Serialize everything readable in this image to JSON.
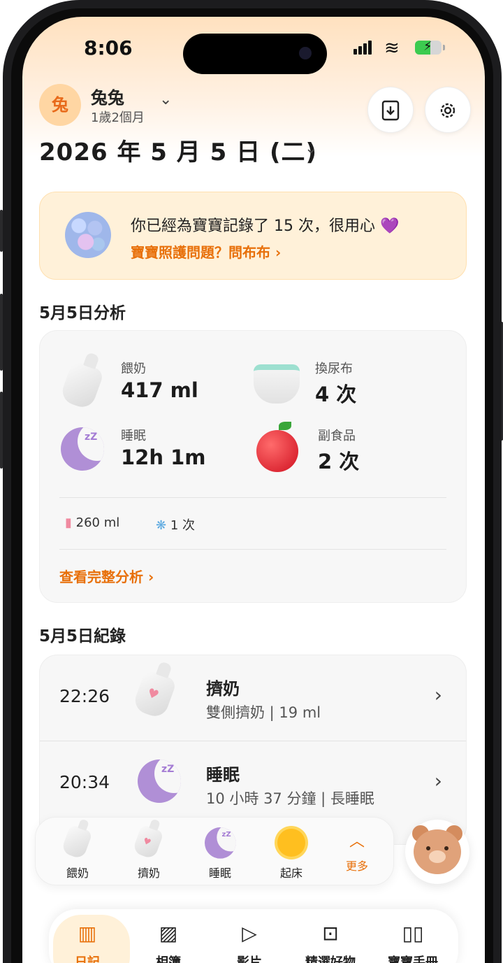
{
  "status": {
    "time": "8:06"
  },
  "header": {
    "avatar_text": "兔",
    "baby_name": "兔兔",
    "baby_age": "1歲2個月"
  },
  "date": {
    "text": "2026 年 5 月 5 日 (二)"
  },
  "banner": {
    "message": "你已經為寶寶記錄了 15 次，很用心 💜",
    "link": "寶寶照護問題？問布布 ›"
  },
  "analysis": {
    "title": "5月5日分析",
    "stats": [
      {
        "label": "餵奶",
        "value": "417 ml",
        "icon": "bottle-icon"
      },
      {
        "label": "換尿布",
        "value": "4 次",
        "icon": "diaper-icon"
      },
      {
        "label": "睡眠",
        "value": "12h 1m",
        "icon": "moon-icon"
      },
      {
        "label": "副食品",
        "value": "2 次",
        "icon": "apple-icon"
      }
    ],
    "mini": [
      {
        "value": "260 ml",
        "icon": "pumped-bottle-icon"
      },
      {
        "value": "1 次",
        "icon": "spit-up-icon"
      }
    ],
    "link": "查看完整分析 ›"
  },
  "records": {
    "title": "5月5日紀錄",
    "items": [
      {
        "time": "22:26",
        "title": "擠奶",
        "subtitle": "雙側擠奶 | 19 ml",
        "icon": "pump-bottle-icon"
      },
      {
        "time": "20:34",
        "title": "睡眠",
        "subtitle": "10 小時 37 分鐘 | 長睡眠",
        "icon": "moon-icon"
      }
    ]
  },
  "quick": {
    "items": [
      {
        "label": "餵奶",
        "icon": "bottle-icon"
      },
      {
        "label": "擠奶",
        "icon": "pump-bottle-icon"
      },
      {
        "label": "睡眠",
        "icon": "moon-icon"
      },
      {
        "label": "起床",
        "icon": "sun-icon"
      }
    ],
    "more_label": "更多"
  },
  "tabs": [
    {
      "label": "日記",
      "icon": "diary-icon",
      "glyph": "▥"
    },
    {
      "label": "相簿",
      "icon": "photo-icon",
      "glyph": "▨"
    },
    {
      "label": "影片",
      "icon": "play-icon",
      "glyph": "▷"
    },
    {
      "label": "精選好物",
      "icon": "shopping-bag-icon",
      "glyph": "⊡"
    },
    {
      "label": "寶寶手冊",
      "icon": "book-icon",
      "glyph": "▯▯"
    }
  ],
  "colors": {
    "accent": "#e8700a",
    "banner_bg": "#fff1d9",
    "card_bg": "#f7f7f7"
  }
}
